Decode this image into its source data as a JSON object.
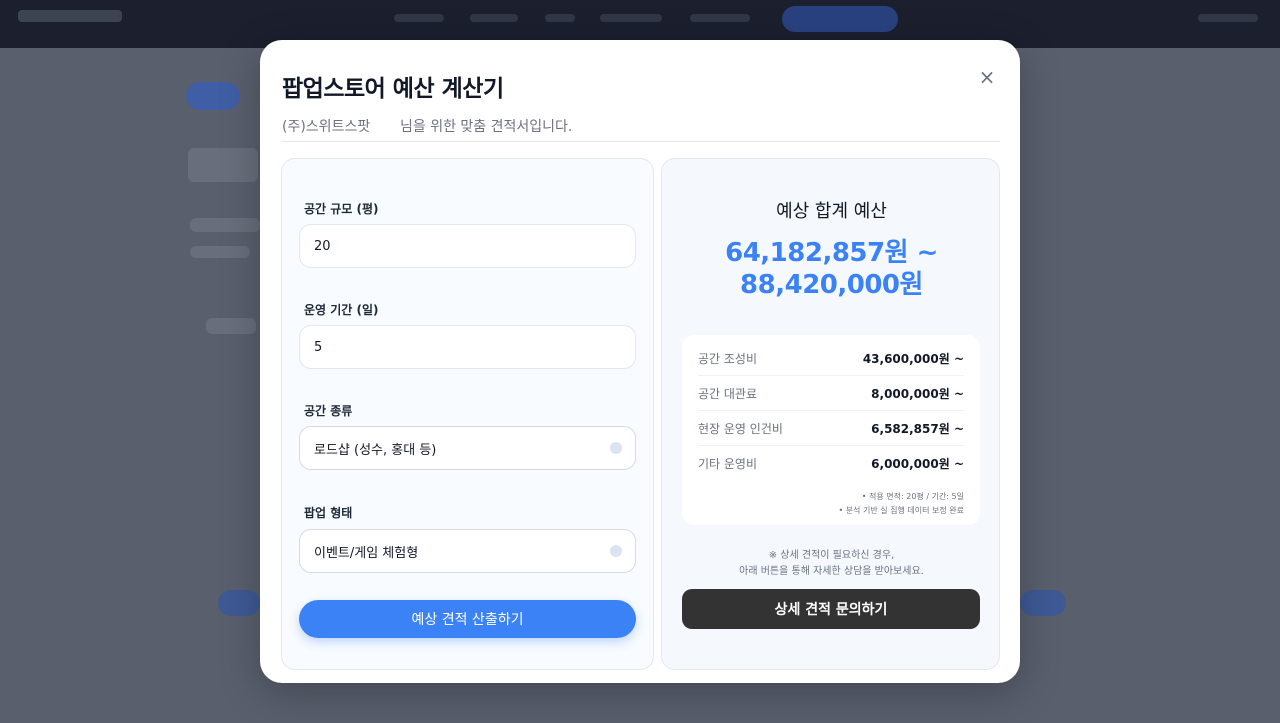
{
  "modal": {
    "title": "팝업스토어 예산 계산기",
    "close_glyph": "×",
    "subtitle_company": "(주)스위트스팟",
    "subtitle_text": "님을 위한 맞춤 견적서입니다."
  },
  "form": {
    "area_label": "공간 규모 (평)",
    "area_value": "20",
    "period_label": "운영 기간 (일)",
    "period_value": "5",
    "space_type_label": "공간 종류",
    "space_type_value": "로드샵 (성수, 홍대 등)",
    "popup_type_label": "팝업 형태",
    "popup_type_value": "이벤트/게임 체험형",
    "calc_button": "예상 견적 산출하기"
  },
  "result": {
    "total_label": "예상 합계 예산",
    "total_min": "64,182,857원 ~",
    "total_max": "88,420,000원",
    "breakdown": [
      {
        "name": "공간 조성비",
        "value": "43,600,000원 ~"
      },
      {
        "name": "공간 대관료",
        "value": "8,000,000원 ~"
      },
      {
        "name": "현장 운영 인건비",
        "value": "6,582,857원 ~"
      },
      {
        "name": "기타 운영비",
        "value": "6,000,000원 ~"
      }
    ],
    "note_1": "• 적용 면적: 20평 / 기간: 5일",
    "note_2": "• 분석 기반 실 집행 데이터 보정 완료",
    "notice_1": "※ 상세 견적이 필요하신 경우,",
    "notice_2": "아래 버튼을 통해 자세한 상담을 받아보세요.",
    "inquiry_button": "상세 견적 문의하기"
  },
  "colors": {
    "accent": "#3b82f6",
    "dark_button": "#333333"
  }
}
